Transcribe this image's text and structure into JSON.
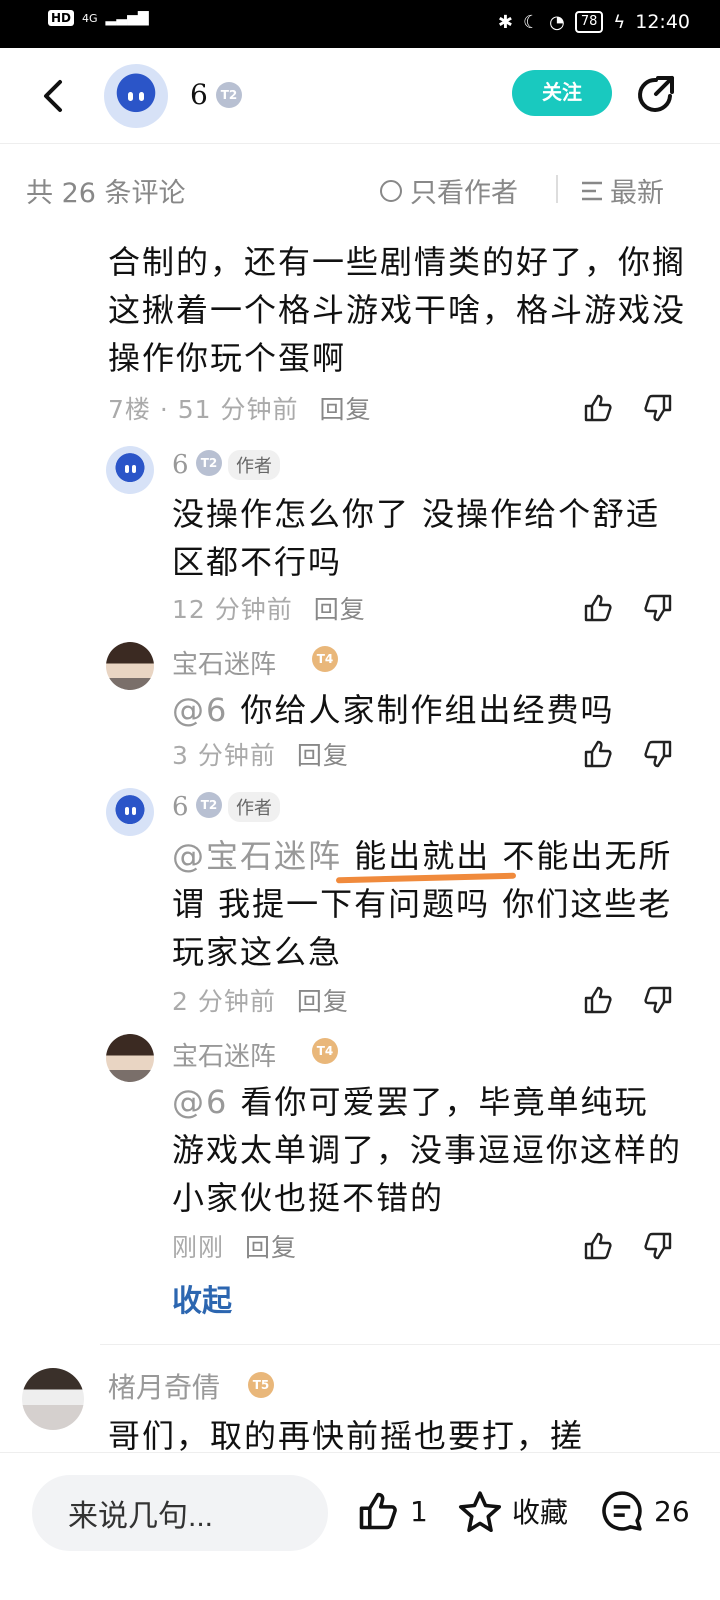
{
  "status_bar": {
    "hd": "HD",
    "signal": "4G",
    "battery": "78",
    "time": "12:40"
  },
  "header": {
    "username": "6",
    "level": "T2",
    "follow_label": "关注"
  },
  "subbar": {
    "count_text": "共 26 条评论",
    "only_author_label": "只看作者",
    "sort_label": "最新"
  },
  "main_comment": {
    "text": "合制的，还有一些剧情类的好了，你搁这揪着一个格斗游戏干啥，格斗游戏没操作你玩个蛋啊",
    "floor": "7楼",
    "time": "· 51 分钟前",
    "reply_label": "回复"
  },
  "replies": [
    {
      "name": "6",
      "level": "T2",
      "author_tag": "作者",
      "mention": "",
      "text": "没操作怎么你了 没操作给个舒适区都不行吗",
      "time": "12 分钟前",
      "reply_label": "回复"
    },
    {
      "name": "宝石迷阵",
      "level": "T4",
      "author_tag": "",
      "mention": "@6",
      "text": "你给人家制作组出经费吗",
      "time": "3 分钟前",
      "reply_label": "回复"
    },
    {
      "name": "6",
      "level": "T2",
      "author_tag": "作者",
      "mention": "@宝石迷阵",
      "text_highlight": "能出就出",
      "text": " 不能出无所谓 我提一下有问题吗 你们这些老玩家这么急",
      "time": "2 分钟前",
      "reply_label": "回复"
    },
    {
      "name": "宝石迷阵",
      "level": "T4",
      "author_tag": "",
      "mention": "@6",
      "text": "看你可爱罢了，毕竟单纯玩游戏太单调了，没事逗逗你这样的小家伙也挺不错的",
      "time": "刚刚",
      "reply_label": "回复"
    }
  ],
  "collapse_label": "收起",
  "next_comment": {
    "name": "楮月奇倩",
    "level": "T5",
    "text": "哥们，取的再快前摇也要打，搓"
  },
  "bottom_bar": {
    "input_placeholder": "来说几句...",
    "like_count": "1",
    "favorite_label": "收藏",
    "comment_count": "26"
  }
}
